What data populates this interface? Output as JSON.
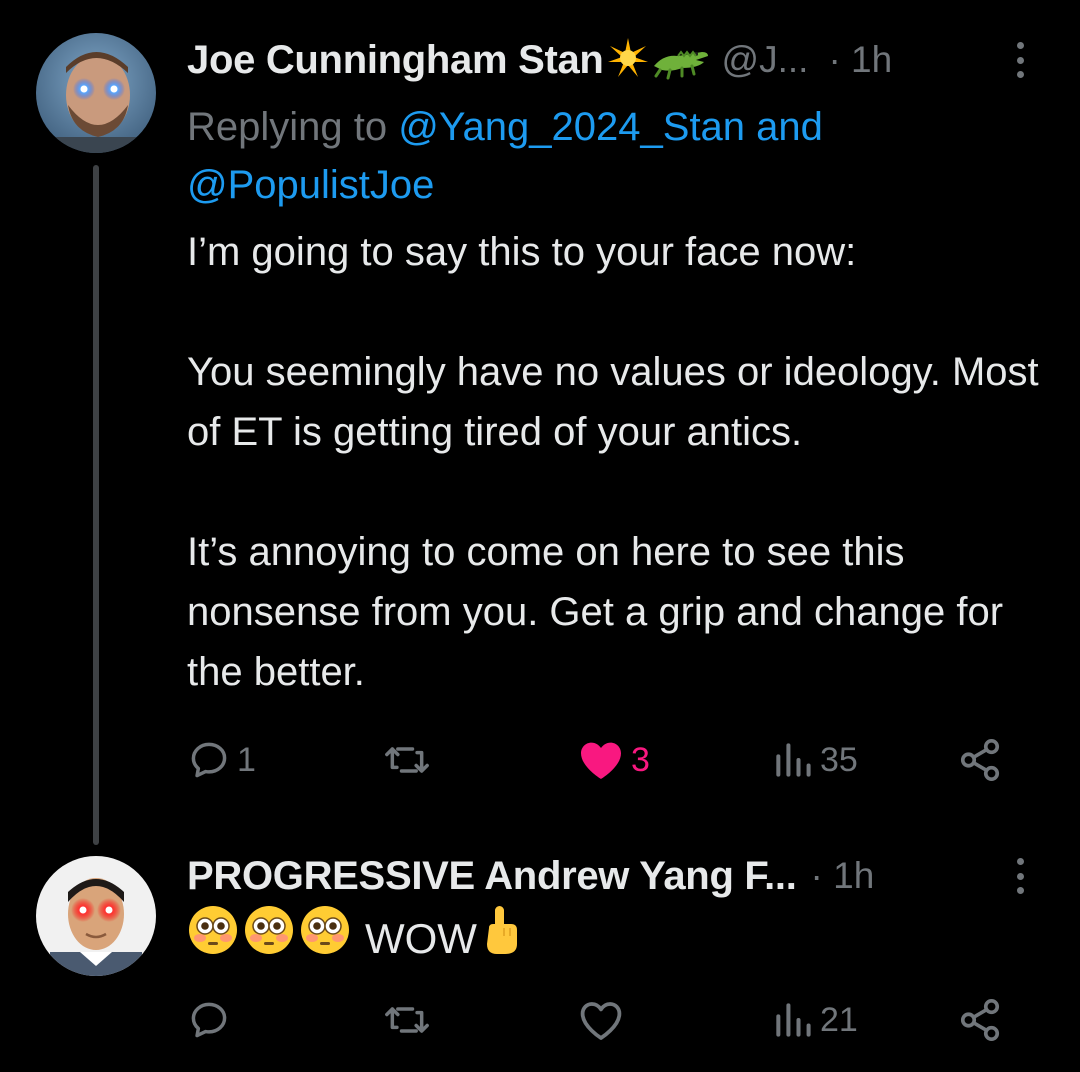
{
  "colors": {
    "background": "#000000",
    "text": "#e7e9ea",
    "muted": "#71767b",
    "link": "#1d9bf0",
    "like": "#f91880",
    "thread_line": "#3e4144"
  },
  "tweets": [
    {
      "display_name": "Joe Cunningham Stan",
      "name_emojis": [
        "sparkle-emoji",
        "crocodile-emoji"
      ],
      "handle": "@J...",
      "time": "· 1h",
      "reply_prefix": "Replying to ",
      "reply_mention_1": "@Yang_2024_Stan",
      "reply_and": " and",
      "reply_mention_2": "@PopulistJoe",
      "body": [
        "I’m going to say this to your face now:",
        "You seemingly have no values or ideology. Most of ET is getting tired of your antics.",
        "It’s annoying to come on here to see this nonsense from you. Get a grip and change for the better."
      ],
      "actions": {
        "reply_count": "1",
        "retweet_count": "",
        "like_count": "3",
        "liked": true,
        "views_count": "35"
      }
    },
    {
      "display_name": "PROGRESSIVE Andrew Yang F...",
      "time": "· 1h",
      "body_emojis": [
        "flushed-face-emoji",
        "flushed-face-emoji",
        "flushed-face-emoji"
      ],
      "body_text": "WOW",
      "body_trailing_emoji": "pointing-up-emoji",
      "actions": {
        "reply_count": "",
        "retweet_count": "",
        "like_count": "",
        "liked": false,
        "views_count": "21"
      }
    }
  ]
}
